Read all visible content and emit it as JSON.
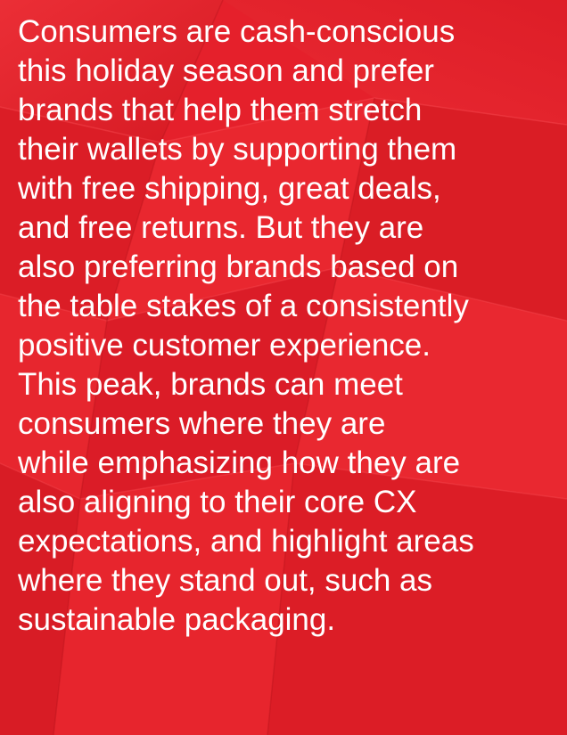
{
  "background": {
    "color": "#e5202b",
    "texture": "folded-paper"
  },
  "paragraph": {
    "color": "#ffffff",
    "lines": [
      "Consumers are cash-conscious",
      "this holiday season and prefer",
      "brands that help them stretch",
      "their wallets by supporting them",
      "with free shipping, great deals,",
      "and free returns. But they are",
      "also preferring brands based on",
      "the table stakes of a consistently",
      "positive customer experience.",
      "This peak, brands can meet",
      "consumers where they are",
      "while emphasizing how they are",
      "also aligning to their core CX",
      "expectations, and highlight areas",
      "where they stand out, such as",
      "sustainable packaging."
    ]
  }
}
